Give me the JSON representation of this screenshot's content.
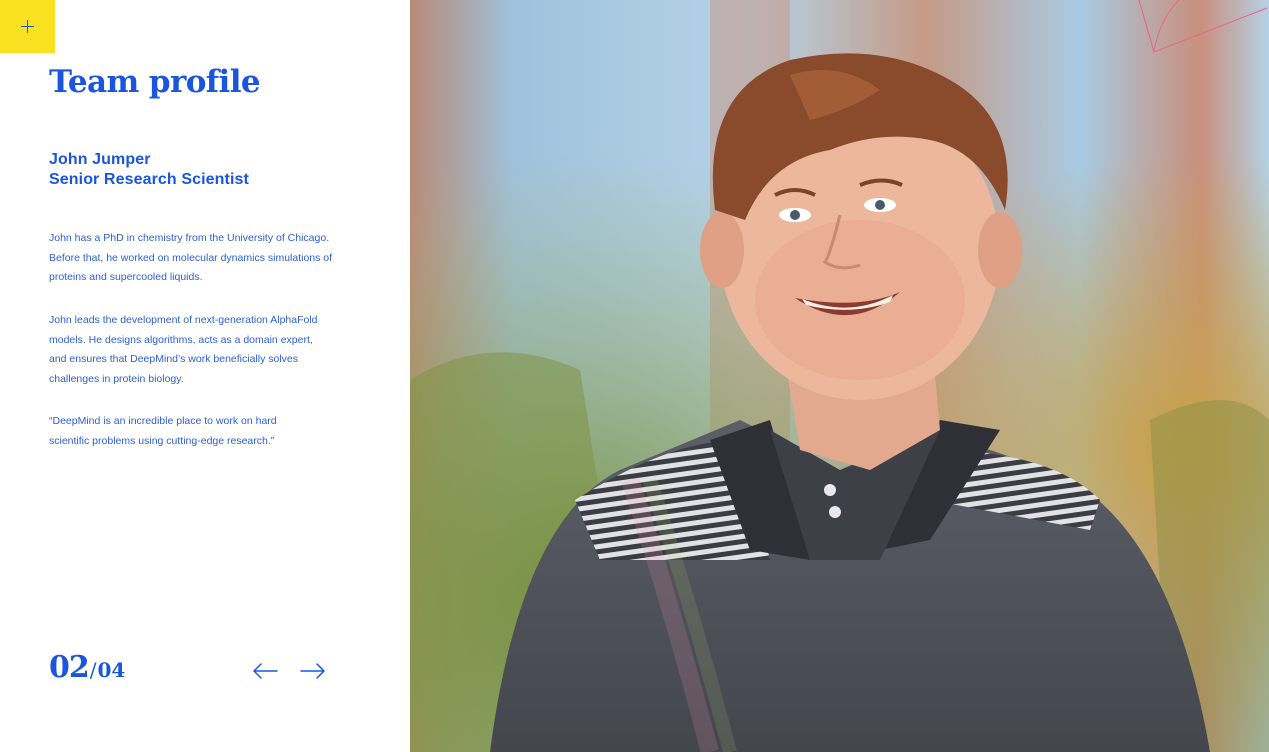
{
  "menu": {
    "icon": "plus-icon",
    "color": "#f7e120"
  },
  "page": {
    "title": "Team profile"
  },
  "profile": {
    "name": "John Jumper",
    "role": "Senior Research Scientist",
    "bio": [
      "John has a PhD in chemistry from the University of Chicago. Before that, he worked on molecular dynamics simulations of proteins and supercooled liquids.",
      "John leads the development of next-generation AlphaFold models. He designs algorithms, acts as a domain expert, and ensures that DeepMind’s work beneficially solves challenges in protein biology.",
      "“DeepMind is an incredible place to work on hard scientific problems using cutting-edge research.”"
    ]
  },
  "pager": {
    "current": "02",
    "separator": "/",
    "total": "04"
  },
  "nav": {
    "prev_icon": "arrow-left-icon",
    "next_icon": "arrow-right-icon"
  },
  "colors": {
    "accent": "#1a56db",
    "yellow": "#f7e120"
  }
}
